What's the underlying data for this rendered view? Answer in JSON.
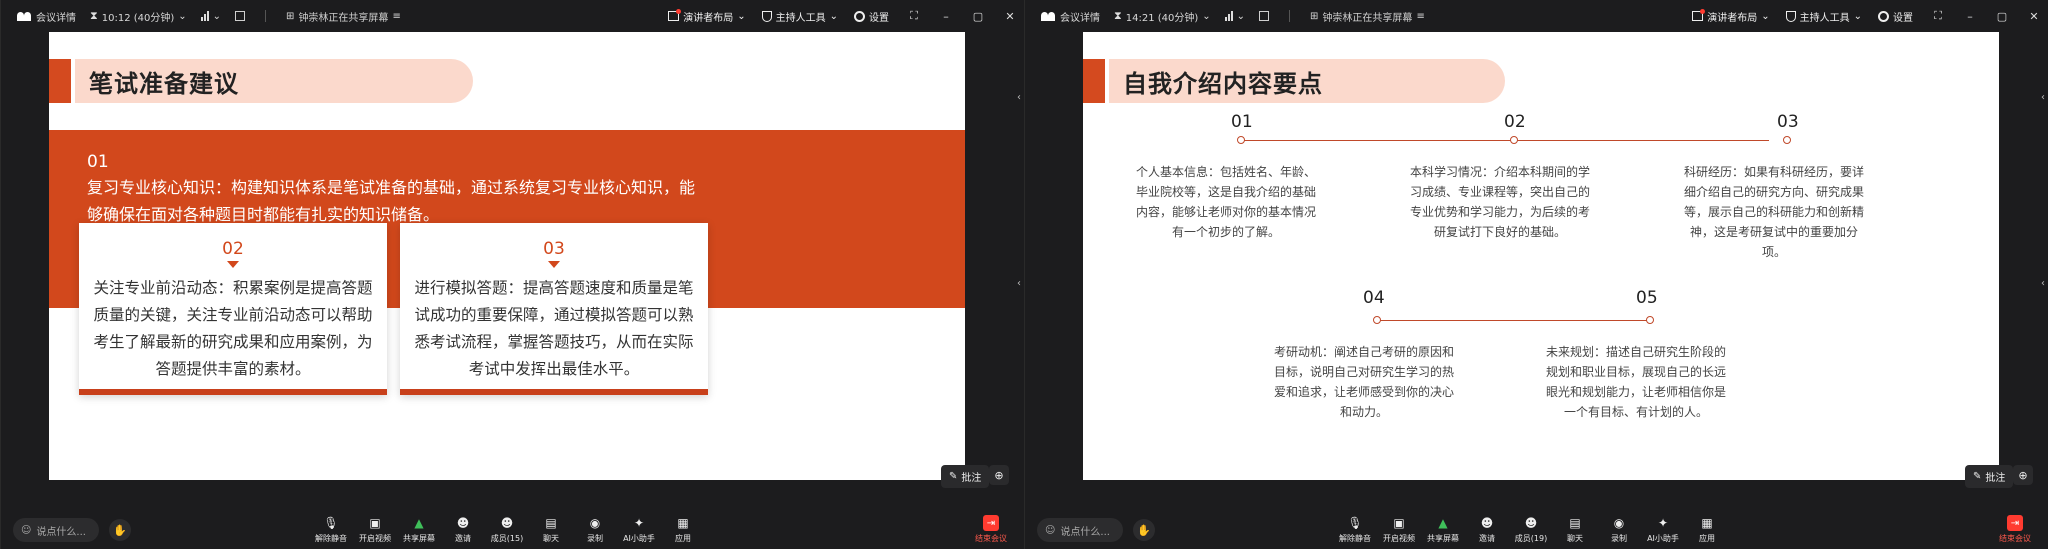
{
  "colors": {
    "accent": "#d2481c",
    "title_pill": "#fbd9cc",
    "app_bg": "#1c1c1e",
    "end_red": "#ff3b30"
  },
  "windows": [
    {
      "topbar": {
        "meeting_info": "会议详情",
        "timer": "10:12 (40分钟)",
        "share_status": "钟崇林正在共享屏幕",
        "presenter_layout": "演讲者布局",
        "host_tools": "主持人工具",
        "settings": "设置"
      },
      "slide": {
        "title": "笔试准备建议",
        "p01": {
          "num": "01",
          "text": "复习专业核心知识：构建知识体系是笔试准备的基础，通过系统复习专业核心知识，能够确保在面对各种题目时都能有扎实的知识储备。"
        },
        "p02": {
          "num": "02",
          "text": "关注专业前沿动态：积累案例是提高答题质量的关键，关注专业前沿动态可以帮助考生了解最新的研究成果和应用案例，为答题提供丰富的素材。"
        },
        "p03": {
          "num": "03",
          "text": "进行模拟答题：提高答题速度和质量是笔试成功的重要保障，通过模拟答题可以熟悉考试流程，掌握答题技巧，从而在实际考试中发挥出最佳水平。"
        }
      },
      "annotate": "批注",
      "bottombar": {
        "say_placeholder": "说点什么...",
        "tools": [
          "解除静音",
          "开启视频",
          "共享屏幕",
          "邀请",
          "成员(15)",
          "聊天",
          "录制",
          "AI小助手",
          "应用"
        ],
        "end": "结束会议"
      }
    },
    {
      "topbar": {
        "meeting_info": "会议详情",
        "timer": "14:21 (40分钟)",
        "share_status": "钟崇林正在共享屏幕",
        "presenter_layout": "演讲者布局",
        "host_tools": "主持人工具",
        "settings": "设置"
      },
      "slide": {
        "title": "自我介绍内容要点",
        "points": [
          {
            "num": "01",
            "text": "个人基本信息：包括姓名、年龄、毕业院校等，这是自我介绍的基础内容，能够让老师对你的基本情况有一个初步的了解。"
          },
          {
            "num": "02",
            "text": "本科学习情况：介绍本科期间的学习成绩、专业课程等，突出自己的专业优势和学习能力，为后续的考研复试打下良好的基础。"
          },
          {
            "num": "03",
            "text": "科研经历：如果有科研经历，要详细介绍自己的研究方向、研究成果等，展示自己的科研能力和创新精神，这是考研复试中的重要加分项。"
          },
          {
            "num": "04",
            "text": "考研动机：阐述自己考研的原因和目标，说明自己对研究生学习的热爱和追求，让老师感受到你的决心和动力。"
          },
          {
            "num": "05",
            "text": "未来规划：描述自己研究生阶段的规划和职业目标，展现自己的长远眼光和规划能力，让老师相信你是一个有目标、有计划的人。"
          }
        ]
      },
      "annotate": "批注",
      "bottombar": {
        "say_placeholder": "说点什么...",
        "tools": [
          "解除静音",
          "开启视频",
          "共享屏幕",
          "邀请",
          "成员(19)",
          "聊天",
          "录制",
          "AI小助手",
          "应用"
        ],
        "end": "结束会议"
      }
    }
  ]
}
